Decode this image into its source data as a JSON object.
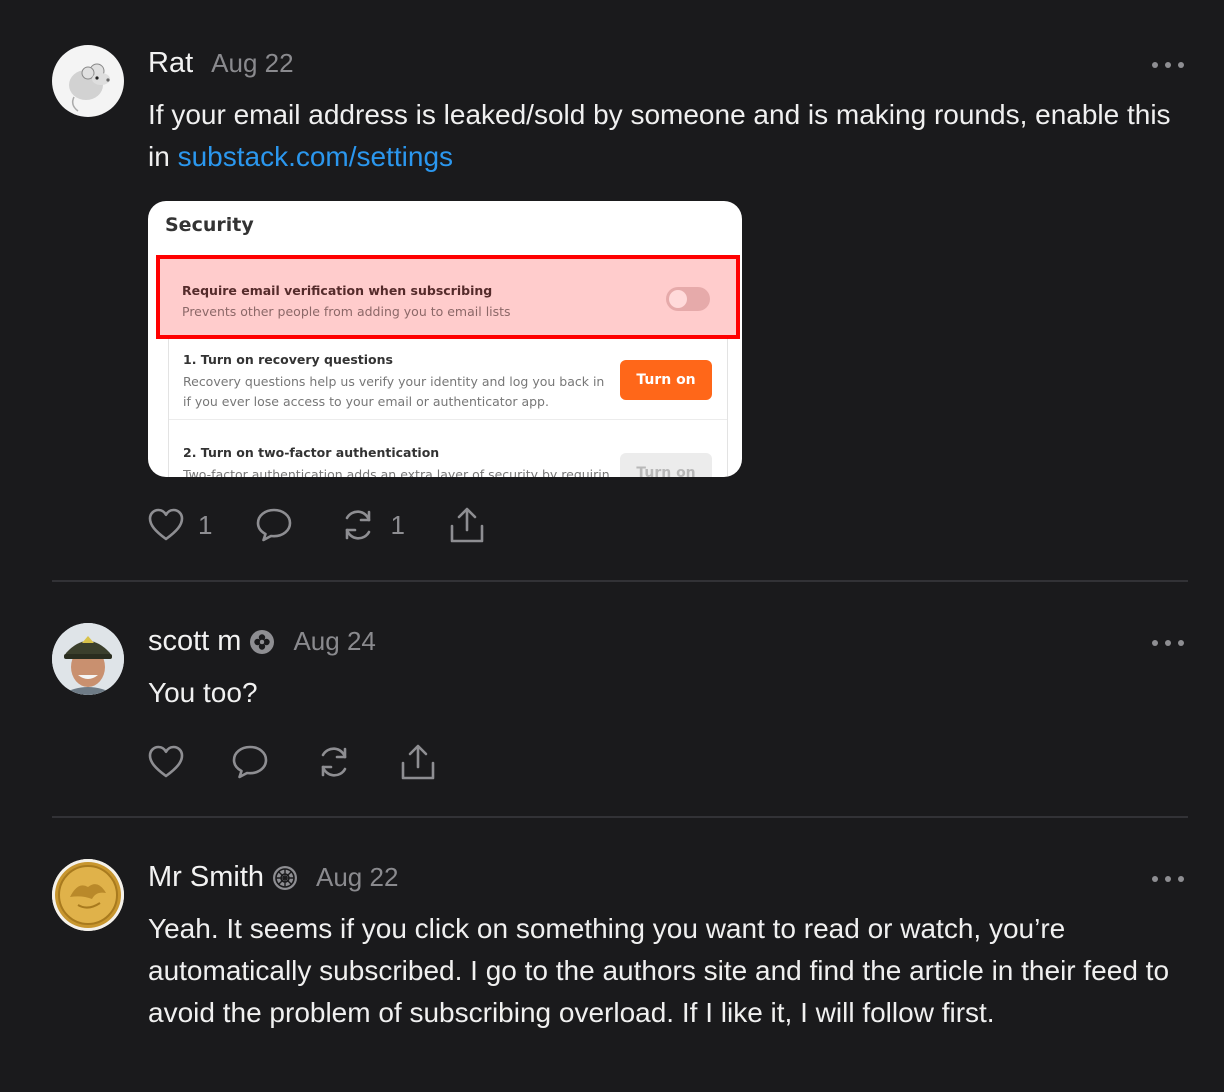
{
  "comments": [
    {
      "author": "Rat",
      "date": "Aug 22",
      "body_pre": "If your email address is leaked/sold by someone and is making rounds, enable this in ",
      "link": "substack.com/settings",
      "likes": "1",
      "restacks": "1"
    },
    {
      "author": "scott m",
      "date": "Aug 24",
      "body": "You too?"
    },
    {
      "author": "Mr Smith",
      "date": "Aug 22",
      "body": "Yeah. It seems if you click on something you want to read or watch, you’re automatically subscribed. I go to the authors site and find the article in their feed to avoid the problem of subscribing overload. If I like it, I will follow first."
    }
  ],
  "screenshot": {
    "title": "Security",
    "highlight_title": "Require email verification when subscribing",
    "highlight_sub": "Prevents other people from adding you to email lists",
    "row1_title": "1. Turn on recovery questions",
    "row1_sub": "Recovery questions help us verify your identity and log you back in if you ever lose access to your email or authenticator app.",
    "row1_button": "Turn on",
    "row2_title": "2. Turn on two-factor authentication",
    "row2_sub": "Two-factor authentication adds an extra layer of security by requiring",
    "row2_button": "Turn on"
  },
  "icons": {
    "like": "heart-icon",
    "reply": "speech-bubble-icon",
    "restack": "repeat-icon",
    "share": "share-icon",
    "more": "ellipsis-icon",
    "badge": "subscriber-badge-icon"
  },
  "colors": {
    "background": "#1a1a1c",
    "link": "#2b97ee",
    "accent": "#ff6719",
    "highlight_border": "#ff0000"
  }
}
